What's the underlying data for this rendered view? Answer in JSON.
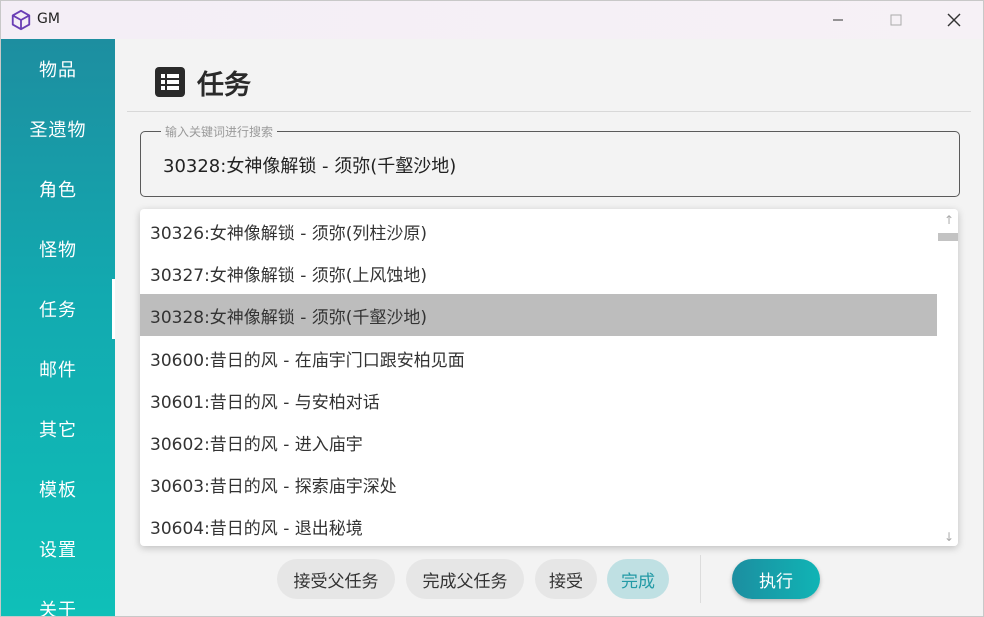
{
  "window": {
    "title": "GM"
  },
  "sidebar": {
    "items": [
      {
        "label": "物品"
      },
      {
        "label": "圣遗物"
      },
      {
        "label": "角色"
      },
      {
        "label": "怪物"
      },
      {
        "label": "任务"
      },
      {
        "label": "邮件"
      },
      {
        "label": "其它"
      },
      {
        "label": "模板"
      },
      {
        "label": "设置"
      },
      {
        "label": "关于"
      }
    ],
    "active_index": 4
  },
  "page": {
    "title": "任务",
    "icon": "list-icon"
  },
  "search": {
    "placeholder": "输入关键词进行搜索",
    "value": "30328:女神像解锁 - 须弥(千壑沙地)"
  },
  "dropdown": {
    "options": [
      "30326:女神像解锁 - 须弥(列柱沙原)",
      "30327:女神像解锁 - 须弥(上风蚀地)",
      "30328:女神像解锁 - 须弥(千壑沙地)",
      "30600:昔日的风 - 在庙宇门口跟安柏见面",
      "30601:昔日的风 - 与安柏对话",
      "30602:昔日的风 - 进入庙宇",
      "30603:昔日的风 - 探索庙宇深处",
      "30604:昔日的风 - 退出秘境"
    ],
    "selected_index": 2
  },
  "actions": {
    "accept_parent": "接受父任务",
    "finish_parent": "完成父任务",
    "accept": "接受",
    "finish": "完成",
    "execute": "执行"
  },
  "colors": {
    "sidebar_top": "#1d8ea0",
    "sidebar_bottom": "#0fc0b8",
    "accent": "#239aa6",
    "selected_row": "#bdbdbd"
  }
}
